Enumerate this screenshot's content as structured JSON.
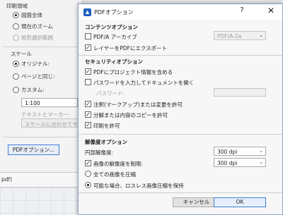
{
  "print_dialog": {
    "print_range_label": "印刷領域",
    "radio_whole_drawing": "図面全体",
    "radio_current_zoom": "現在のズーム",
    "radio_rect_selection": "矩形選択範囲",
    "scale_label": "スケール",
    "radio_original": "オリジナル:",
    "radio_same_as_page": "ページと同じ:",
    "radio_custom": "カスタム:",
    "scale_value": "1:100",
    "text_and_markers_label": "テキストとマーカー:",
    "text_markers_value": "スケールに合わせてサイズ変",
    "pdf_options_button": "PDFオプション...",
    "strip_text": "pdf)"
  },
  "pdf_dialog": {
    "title": "PDFオプション",
    "help_glyph": "?",
    "close_glyph": "✕",
    "compat": {
      "heading": "コンテンツオプション",
      "pdfa_label": "PDF/A アーカイブ",
      "pdfa_checked": false,
      "pdfa_version": "PDF/A-2a",
      "layers_label": "レイヤーをPDFにエクスポート",
      "layers_checked": true
    },
    "security": {
      "heading": "セキュリティオプション",
      "include_project_info": "PDFにプロジェクト情報を含める",
      "include_project_info_checked": true,
      "password_open": "パスワードを入力してドキュメントを開く",
      "password_open_checked": false,
      "password_label": "パスワード:",
      "password_value": "",
      "allow_annotations": "注釈(マークアップ)または変更を許可",
      "allow_annotations_checked": true,
      "allow_copy": "分解または内容のコピーを許可",
      "allow_copy_checked": true,
      "allow_print": "印刷を許可",
      "allow_print_checked": true
    },
    "resolution": {
      "heading": "解像度オプション",
      "raster_label": "円部解像度:",
      "raster_value": "300 dpi",
      "limit_label": "画像の解像度を制限:",
      "limit_checked": true,
      "limit_value": "300 dpi",
      "compress_all": "全ての画像を圧縮",
      "compress_all_selected": false,
      "lossless_when_possible": "可能な場合、ロスレス画像圧縮を保持",
      "lossless_selected": true
    },
    "cancel_button": "キャンセル",
    "ok_button": "OK"
  },
  "colors": {
    "accent": "#3c7fd6",
    "app_icon": "#1f5fbf"
  }
}
